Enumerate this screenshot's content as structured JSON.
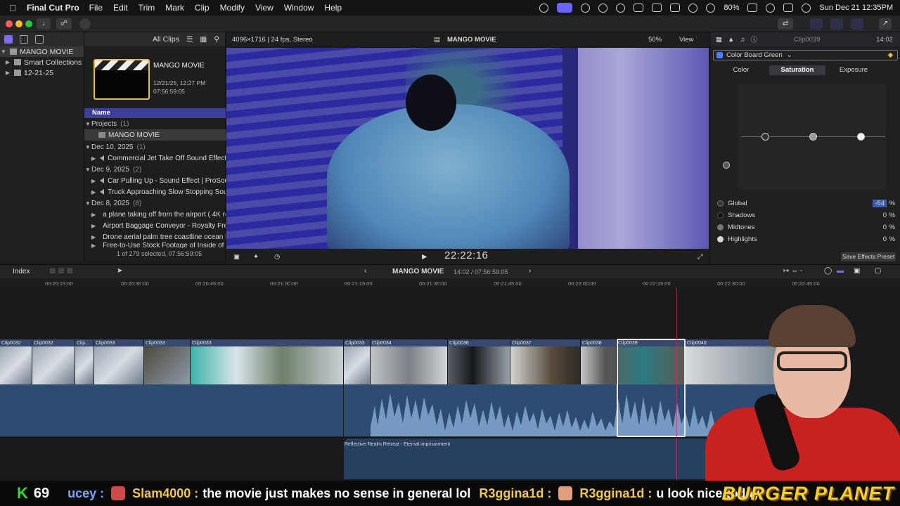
{
  "menubar": {
    "app": "Final Cut Pro",
    "items": [
      "File",
      "Edit",
      "Trim",
      "Mark",
      "Clip",
      "Modify",
      "View",
      "Window",
      "Help"
    ],
    "battery": "80%",
    "datetime": "Sun Dec 21  12:35PM"
  },
  "libraries": {
    "root": "MANGO MOVIE",
    "items": [
      "Smart Collections",
      "12-21-25"
    ]
  },
  "browser": {
    "filter": "All Clips",
    "card_title": "MANGO MOVIE",
    "card_date": "12/21/25, 12:27 PM",
    "card_duration": "07:56:59:05",
    "column_name": "Name",
    "groups": [
      {
        "label": "Projects",
        "count": "(1)",
        "rows": [
          "MANGO MOVIE"
        ]
      },
      {
        "label": "Dec 10, 2025",
        "count": "(1)",
        "rows": [
          "Commercial Jet Take Off Sound Effect"
        ]
      },
      {
        "label": "Dec 9, 2025",
        "count": "(2)",
        "rows": [
          "Car Pulling Up - Sound Effect  |  ProSound",
          "Truck Approaching Slow Stopping Sound"
        ]
      },
      {
        "label": "Dec 8, 2025",
        "count": "(8)",
        "rows": [
          "a plane taking off from the airport ( 4K ro",
          "Airport Baggage Conveyor - Royalty Free",
          "Drone aerial palm tree coastline ocean be",
          "Free-to-Use Stock Footage of Inside of A"
        ]
      }
    ],
    "selection": "1 of 279 selected, 07:56:59:05"
  },
  "viewer": {
    "format": "4096×1716 | 24 fps, Stereo",
    "project": "MANGO MOVIE",
    "zoom": "50%",
    "view": "View",
    "timecode": "22:22:16"
  },
  "inspector": {
    "clip": "Clip0039",
    "duration": "14:02",
    "effect": "Color Board Green",
    "tabs": [
      "Color",
      "Saturation",
      "Exposure"
    ],
    "params": [
      {
        "name": "Global",
        "value": "-54"
      },
      {
        "name": "Shadows",
        "value": "0"
      },
      {
        "name": "Midtones",
        "value": "0"
      },
      {
        "name": "Highlights",
        "value": "0"
      }
    ],
    "unit": "%",
    "save_label": "Save Effects Preset"
  },
  "timeline": {
    "index": "Index",
    "project": "MANGO MOVIE",
    "position": "14:02 / 07:56:59:05",
    "ruler": [
      "00:20:15:00",
      "00:20:30:00",
      "00:20:45:00",
      "00:21:00:00",
      "00:21:15:00",
      "00:21:30:00",
      "00:21:45:00",
      "00:22:00:00",
      "00:22:15:00",
      "00:22:30:00",
      "00:22:45:00"
    ],
    "clips": [
      "Clip0032",
      "Clip0032",
      "Clip...",
      "Clip0033",
      "Clip0033",
      "Clip0033",
      "Clip0033",
      "Clip0034",
      "Clip0036",
      "Clip0037",
      "Clip0038",
      "Clip0039",
      "Clip0040"
    ],
    "music": "Reflective Realm Retreat - Eternal imprisonment"
  },
  "chat": {
    "k_label": "K",
    "k_count": "69",
    "user0": "ucey :",
    "user1": "Slam4000 :",
    "msg1": "the movie just makes no sense in general lol",
    "user2": "R3ggina1d :",
    "user3": "R3ggina1d :",
    "msg3": "u look nice today",
    "brand": "BURGER PLANET"
  }
}
